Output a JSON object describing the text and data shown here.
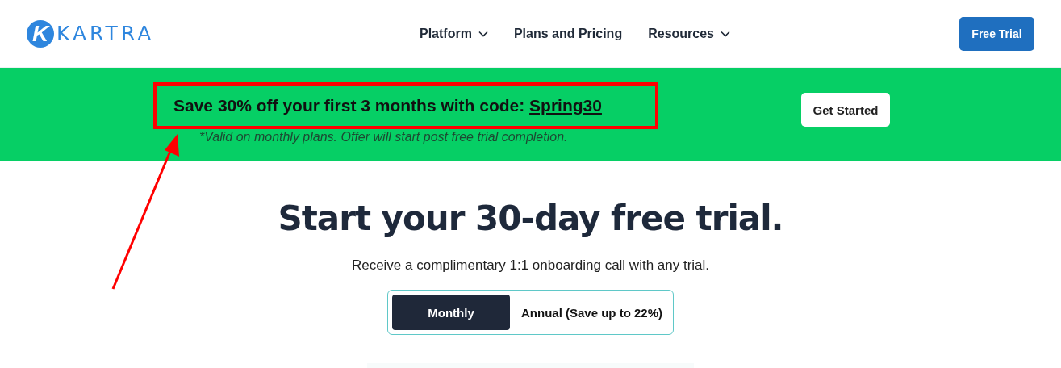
{
  "header": {
    "logo": {
      "mark": "K",
      "text": "KARTRA"
    },
    "nav": [
      {
        "label": "Platform",
        "dropdown": true
      },
      {
        "label": "Plans and Pricing",
        "dropdown": false
      },
      {
        "label": "Resources",
        "dropdown": true
      }
    ],
    "cta": "Free Trial"
  },
  "promo": {
    "headline": "Save 30% off your first 3 months with code: ",
    "code": "Spring30",
    "note": "*Valid on monthly plans. Offer will start post free trial completion.",
    "button": "Get Started",
    "highlighted": true
  },
  "hero": {
    "title": "Start your 30-day free trial.",
    "subtitle": "Receive a complimentary 1:1 onboarding call with any trial.",
    "billing": [
      {
        "label": "Monthly",
        "selected": true
      },
      {
        "label": "Annual (Save up to 22%)",
        "selected": false
      }
    ]
  }
}
